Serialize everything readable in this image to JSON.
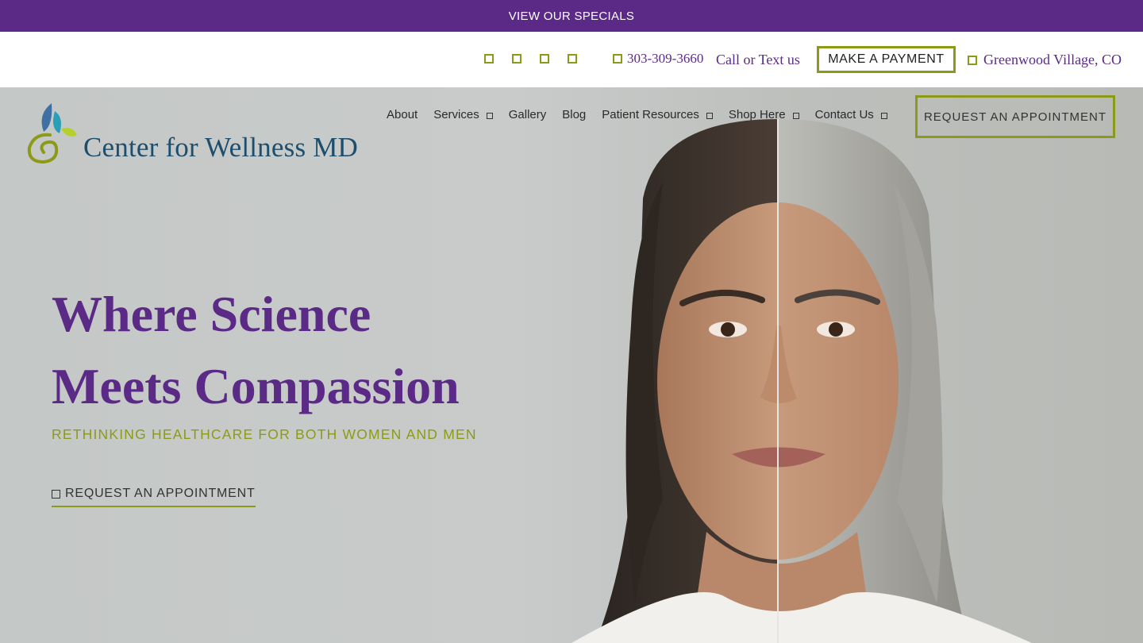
{
  "promo": {
    "label": "VIEW OUR SPECIALS"
  },
  "utility": {
    "phone": "303-309-3660",
    "call_text": "Call or Text us",
    "payment_button": "MAKE A PAYMENT",
    "location": "Greenwood Village, CO",
    "social_icons": [
      "social-icon-1",
      "social-icon-2",
      "social-icon-3",
      "social-icon-4"
    ]
  },
  "logo": {
    "text": "Center for Wellness MD"
  },
  "nav": {
    "items": [
      {
        "label": "About",
        "has_dropdown": false
      },
      {
        "label": "Services",
        "has_dropdown": true
      },
      {
        "label": "Gallery",
        "has_dropdown": false
      },
      {
        "label": "Blog",
        "has_dropdown": false
      },
      {
        "label": "Patient Resources",
        "has_dropdown": true
      },
      {
        "label": "Shop Here",
        "has_dropdown": true
      },
      {
        "label": "Contact Us",
        "has_dropdown": true
      }
    ],
    "request_button": "REQUEST AN APPOINTMENT"
  },
  "hero": {
    "heading_line1": "Where Science",
    "heading_line2": "Meets Compassion",
    "tagline": "RETHINKING HEALTHCARE FOR BOTH WOMEN AND MEN",
    "cta": "REQUEST AN APPOINTMENT"
  },
  "colors": {
    "purple": "#5b2a86",
    "olive": "#8d9a17",
    "logo_blue": "#1d4e6e"
  }
}
